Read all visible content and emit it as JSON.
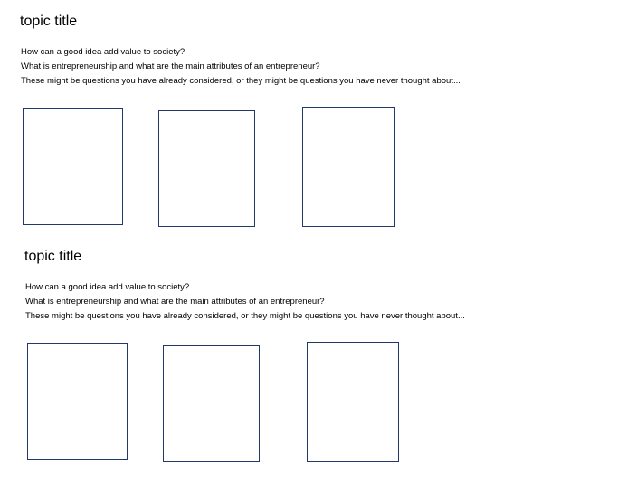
{
  "sections": [
    {
      "title": "topic title",
      "lines": [
        "How can a good idea add value to society?",
        "What is entrepreneurship and what are the main attributes of an entrepreneur?",
        "These might be questions you have already considered, or they might be questions you have never thought about..."
      ]
    },
    {
      "title": "topic title",
      "lines": [
        "How can a good idea add value to society?",
        "What is entrepreneurship and what are the main attributes of an entrepreneur?",
        "These might be questions you have already considered, or they might be questions you have never thought about..."
      ]
    }
  ],
  "colors": {
    "box_border": "#1f3a68",
    "text": "#000000",
    "background": "#ffffff"
  }
}
